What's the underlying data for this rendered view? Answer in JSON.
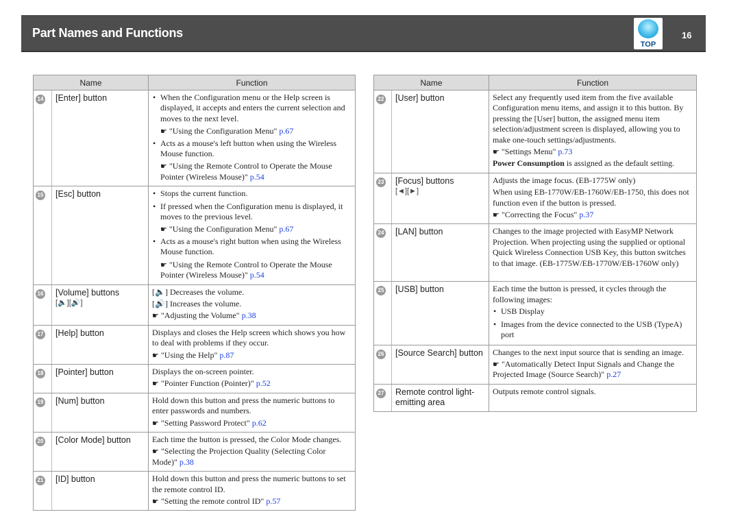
{
  "header": {
    "title": "Part Names and Functions",
    "top_label": "TOP",
    "page": "16"
  },
  "columns": {
    "name": "Name",
    "function": "Function"
  },
  "left": [
    {
      "num": "14",
      "name": "[Enter] button",
      "h": 133,
      "items": [
        {
          "t": "bul",
          "text": "When the Configuration menu or the Help screen is displayed, it accepts and enters the current selection and moves to the next level."
        },
        {
          "t": "ref",
          "in": true,
          "text": "\"Using the Configuration Menu\"",
          "link": "p.67"
        },
        {
          "t": "bul",
          "text": "Acts as a mouse's left button when using the Wireless Mouse function."
        },
        {
          "t": "ref",
          "in": true,
          "text": "\"Using the Remote Control to Operate the Mouse Pointer (Wireless Mouse)\"",
          "link": "p.54"
        }
      ]
    },
    {
      "num": "15",
      "name": "[Esc] button",
      "h": 139,
      "items": [
        {
          "t": "bul",
          "text": "Stops the current function."
        },
        {
          "t": "bul",
          "text": "If pressed when the Configuration menu is displayed, it moves to the previous level."
        },
        {
          "t": "ref",
          "in": true,
          "text": "\"Using the Configuration Menu\"",
          "link": "p.67"
        },
        {
          "t": "bul",
          "text": "Acts as a mouse's right button when using the Wireless Mouse function."
        },
        {
          "t": "ref",
          "in": true,
          "text": "\"Using the Remote Control to Operate the Mouse Pointer (Wireless Mouse)\"",
          "link": "p.54"
        }
      ]
    },
    {
      "num": "16",
      "name": "[Volume] buttons",
      "sub": "[🔈][🔊]",
      "h": 58,
      "items": [
        {
          "t": "p",
          "text": "[🔈] Decreases the volume."
        },
        {
          "t": "p",
          "text": "[🔊] Increases the volume."
        },
        {
          "t": "ref",
          "text": "\"Adjusting the Volume\"",
          "link": "p.38"
        }
      ]
    },
    {
      "num": "17",
      "name": "[Help] button",
      "h": 55,
      "items": [
        {
          "t": "p",
          "text": "Displays and closes the Help screen which shows you how to deal with problems if they occur."
        },
        {
          "t": "ref",
          "text": "\"Using the Help\"",
          "link": "p.87"
        }
      ]
    },
    {
      "num": "18",
      "name": "[Pointer] button",
      "h": 40,
      "items": [
        {
          "t": "p",
          "text": "Displays the on-screen pointer."
        },
        {
          "t": "ref",
          "text": "\"Pointer Function (Pointer)\"",
          "link": "p.52"
        }
      ]
    },
    {
      "num": "19",
      "name": "[Num] button",
      "h": 55,
      "items": [
        {
          "t": "p",
          "text": "Hold down this button and press the numeric buttons to enter passwords and numbers."
        },
        {
          "t": "ref",
          "text": "\"Setting Password Protect\"",
          "link": "p.62"
        }
      ]
    },
    {
      "num": "20",
      "name": "[Color Mode] button",
      "h": 56,
      "items": [
        {
          "t": "p",
          "text": "Each time the button is pressed, the Color Mode changes."
        },
        {
          "t": "ref",
          "text": "\"Selecting the Projection Quality (Selecting Color Mode)\"",
          "link": "p.38"
        }
      ]
    },
    {
      "num": "21",
      "name": "[ID] button",
      "h": 55,
      "items": [
        {
          "t": "p",
          "text": "Hold down this button and press the numeric buttons to set the remote control ID."
        },
        {
          "t": "ref",
          "text": "\"Setting the remote control ID\"",
          "link": "p.57"
        }
      ]
    }
  ],
  "right": [
    {
      "num": "22",
      "name": "[User] button",
      "h": 119,
      "items": [
        {
          "t": "p",
          "text": "Select any frequently used item from the five available Configuration menu items, and assign it to this button. By pressing the [User] button, the assigned menu item selection/adjustment screen is displayed, allowing you to make one-touch settings/adjustments."
        },
        {
          "t": "ref",
          "text": "\"Settings Menu\"",
          "link": "p.73"
        },
        {
          "t": "p",
          "bold": "Power Consumption",
          "text": " is assigned as the default setting."
        }
      ]
    },
    {
      "num": "23",
      "name": "[Focus] buttons",
      "sub": "[◄][►]",
      "h": 74,
      "items": [
        {
          "t": "p",
          "text": "Adjusts the image focus. (EB-1775W only)"
        },
        {
          "t": "p",
          "text": "When using EB-1770W/EB-1760W/EB-1750, this does not function even if the button is pressed."
        },
        {
          "t": "ref",
          "text": "\"Correcting the Focus\"",
          "link": "p.37"
        }
      ]
    },
    {
      "num": "24",
      "name": "[LAN] button",
      "h": 84,
      "items": [
        {
          "t": "p",
          "text": "Changes to the image projected with EasyMP Network Projection. When projecting using the supplied or optional Quick Wireless Connection USB Key, this button switches to that image. (EB-1775W/EB-1770W/EB-1760W only)"
        }
      ]
    },
    {
      "num": "25",
      "name": "[USB] button",
      "h": 86,
      "items": [
        {
          "t": "p",
          "text": "Each time the button is pressed, it cycles through the following images:"
        },
        {
          "t": "bul",
          "text": "USB Display"
        },
        {
          "t": "bul",
          "text": "Images from the device connected to the USB (TypeA) port"
        }
      ]
    },
    {
      "num": "26",
      "name": "[Source Search] button",
      "h": 56,
      "items": [
        {
          "t": "p",
          "text": "Changes to the next input source that is sending an image."
        },
        {
          "t": "ref",
          "text": "\"Automatically Detect Input Signals and Change the Projected Image (Source Search)\"",
          "link": "p.27"
        }
      ]
    },
    {
      "num": "27",
      "name": "Remote control light-emitting area",
      "h": 37,
      "items": [
        {
          "t": "p",
          "text": "Outputs remote control signals."
        }
      ]
    }
  ]
}
